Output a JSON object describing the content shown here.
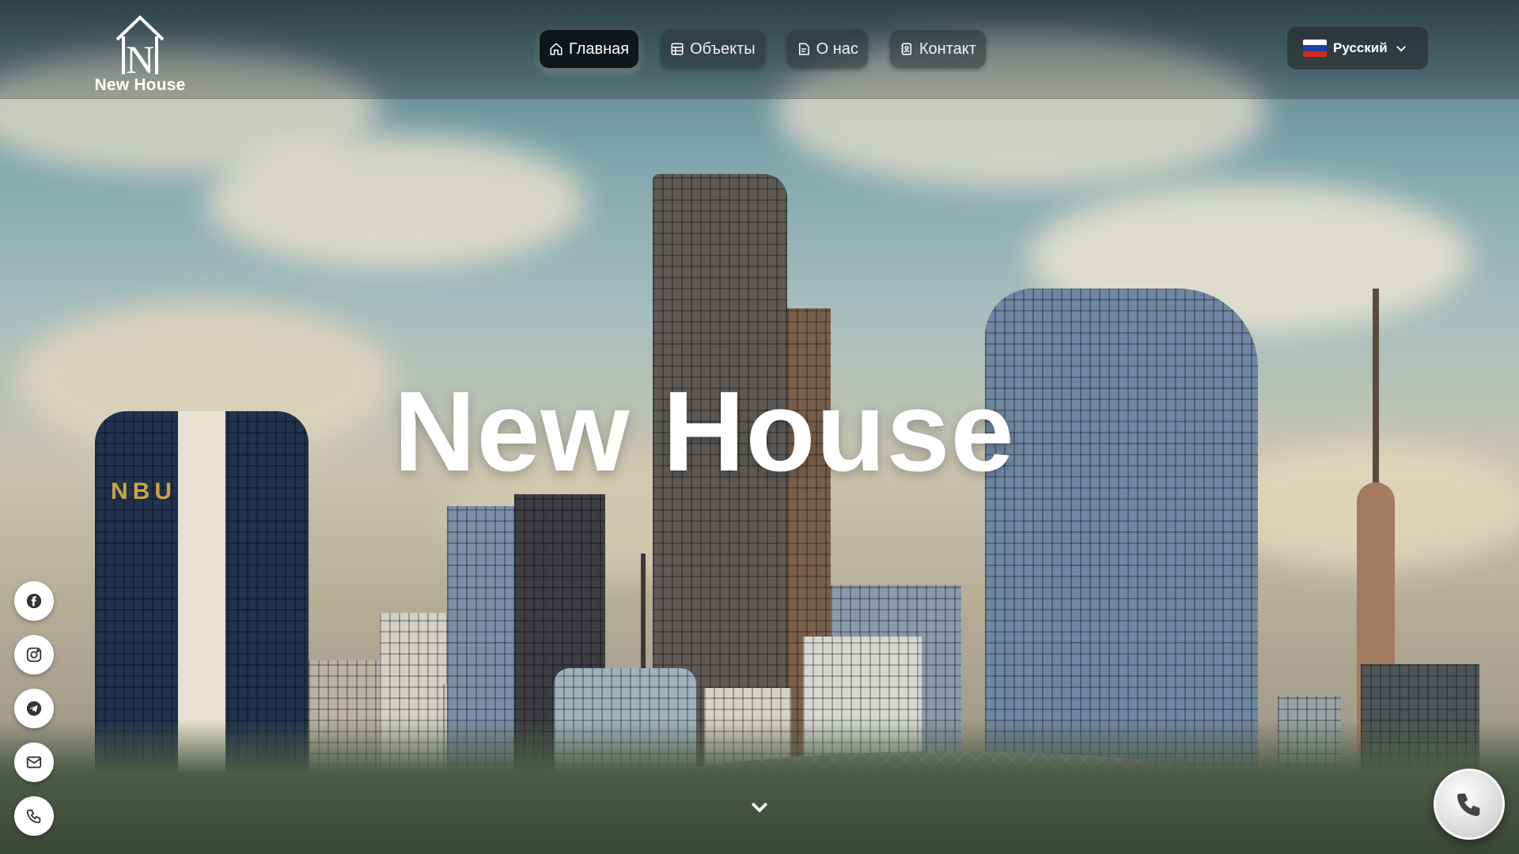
{
  "brand": {
    "name": "New House",
    "mark": "N"
  },
  "nav": {
    "items": [
      {
        "label": "Главная",
        "icon": "home-icon",
        "active": true
      },
      {
        "label": "Объекты",
        "icon": "building-grid-icon",
        "active": false
      },
      {
        "label": "О нас",
        "icon": "document-icon",
        "active": false
      },
      {
        "label": "Контакт",
        "icon": "contact-card-icon",
        "active": false
      }
    ]
  },
  "language": {
    "selected": "Русский",
    "flag": "russia-flag-icon"
  },
  "hero": {
    "title": "New House"
  },
  "building_signs": {
    "left_tower": "NBU"
  },
  "socials": [
    "facebook-icon",
    "instagram-icon",
    "telegram-icon",
    "mail-icon",
    "phone-icon"
  ],
  "colors": {
    "accent": "#0c0e10",
    "text": "#ffffff",
    "nav_bg": "#283237"
  }
}
